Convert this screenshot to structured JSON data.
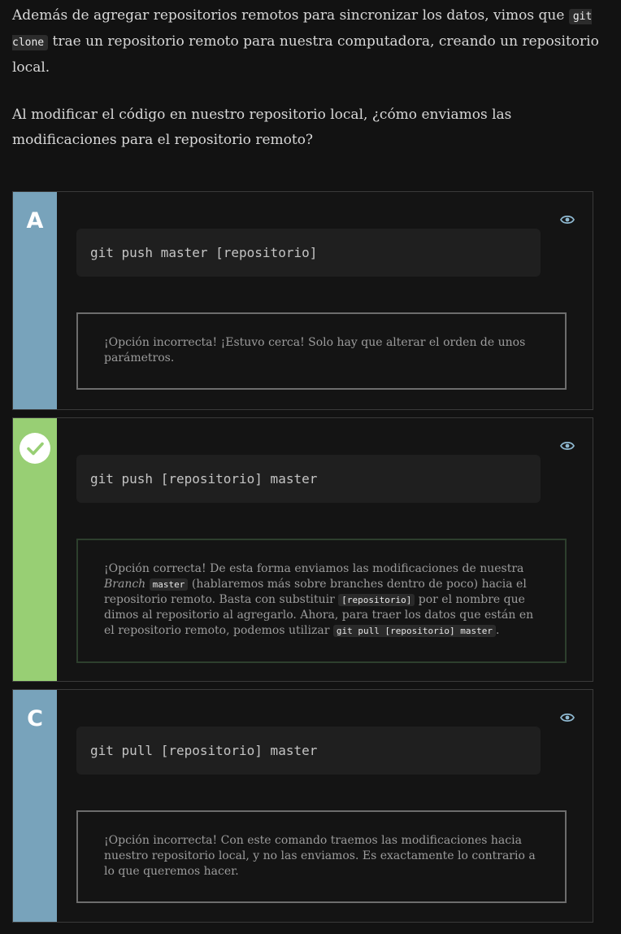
{
  "intro": {
    "p1_before": "Además de agregar repositorios remotos para sincronizar los datos, vimos que ",
    "p1_code": "git clone",
    "p1_after": " trae un repositorio remoto para nuestra computadora, creando un repositorio local.",
    "p2": "Al modificar el código en nuestro repositorio local, ¿cómo enviamos las modificaciones para el repositorio remoto?"
  },
  "options": [
    {
      "letter": "A",
      "code": "git push master [repositorio]",
      "feedback": "¡Opción incorrecta! ¡Estuvo cerca! Solo hay que alterar el orden de unos parámetros.",
      "status": "incorrect",
      "accent_color": "#78a3bb"
    },
    {
      "letter": "",
      "code": "git push [repositorio] master",
      "feedback_parts": {
        "t1": "¡Opción correcta! De esta forma enviamos las modificaciones de nuestra ",
        "em1": "Branch",
        "code1": "master",
        "t2": " (hablaremos más sobre branches dentro de poco) hacia el repositorio remoto. Basta con substituir ",
        "code2": "[repositorio]",
        "t3": " por el nombre que dimos al repositorio al agregarlo. Ahora, para traer los datos que están en el repositorio remoto, podemos utilizar ",
        "code3": "git pull [repositorio] master",
        "t4": "."
      },
      "status": "correct",
      "icon": "check-icon",
      "accent_color": "#98cf74"
    },
    {
      "letter": "C",
      "code": "git pull [repositorio] master",
      "feedback": "¡Opción incorrecta! Con este comando traemos las modificaciones hacia nuestro repositorio local, y no las enviamos. Es exactamente lo contrario a lo que queremos hacer.",
      "status": "incorrect",
      "accent_color": "#78a3bb"
    }
  ],
  "icons": {
    "view": "eye-icon"
  }
}
